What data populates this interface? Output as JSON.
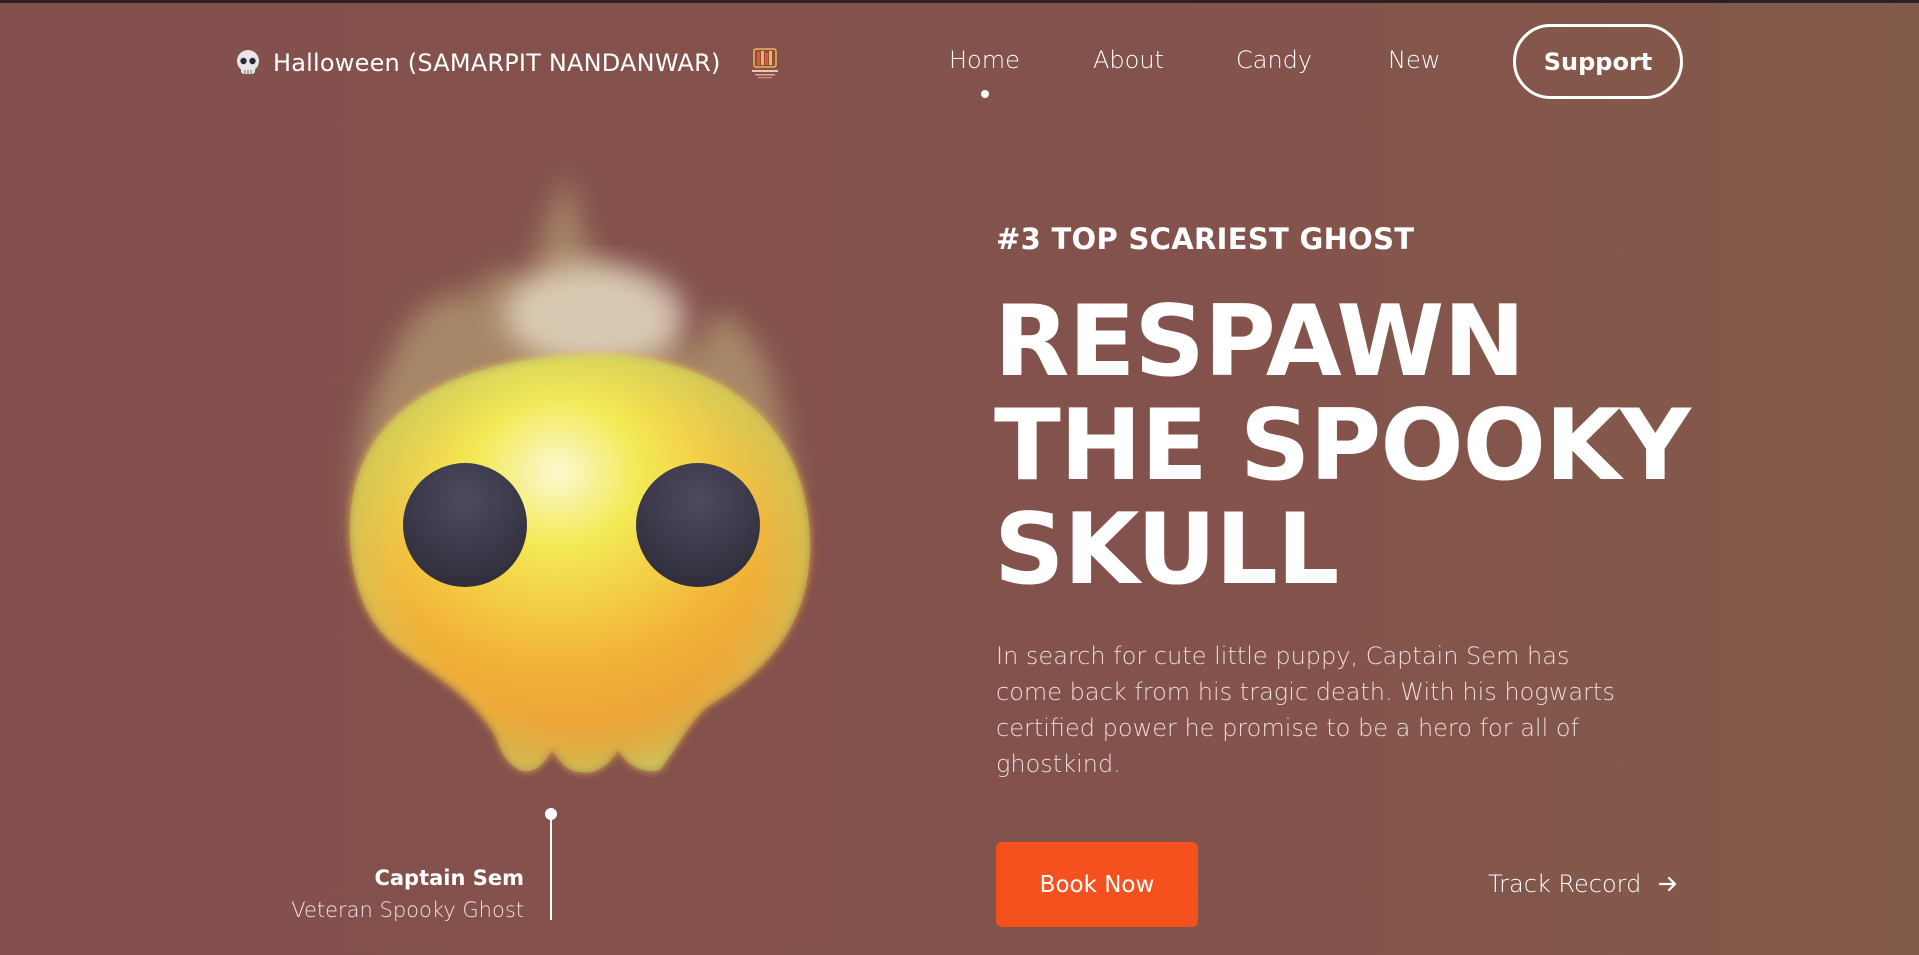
{
  "brand": {
    "title": "Halloween (SAMARPIT NANDANWAR)",
    "icon": "skull-icon",
    "logo": "bookshelf-logo"
  },
  "nav": {
    "items": [
      {
        "label": "Home",
        "active": true
      },
      {
        "label": "About",
        "active": false
      },
      {
        "label": "Candy",
        "active": false
      },
      {
        "label": "New",
        "active": false
      }
    ],
    "support_label": "Support"
  },
  "hero": {
    "eyebrow": "#3 TOP SCARIEST GHOST",
    "headline": [
      "RESPAWN",
      "THE SPOOKY",
      "SKULL"
    ],
    "description": "In search for cute little puppy, Captain Sem has come back from his tragic death. With his hogwarts certified power he promise to be a hero for all of ghostkind.",
    "book_label": "Book Now",
    "track_label": "Track Record",
    "track_icon": "arrow-right-icon"
  },
  "character": {
    "name": "Captain Sem",
    "role": "Veteran Spooky Ghost",
    "illustration": "flaming-skull-illustration"
  },
  "colors": {
    "background": "#84514c",
    "accent": "#f4511e",
    "text": "#ffffff"
  }
}
